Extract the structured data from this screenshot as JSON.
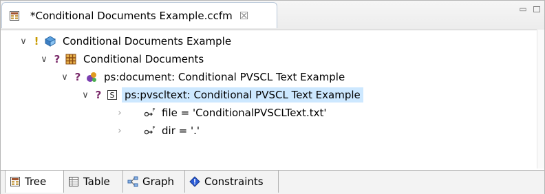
{
  "editor": {
    "tab_title": "*Conditional Documents Example.ccfm",
    "close_glyph": "☒"
  },
  "tree": {
    "nodes": [
      {
        "label": "Conditional Documents Example",
        "flag": "!",
        "icon": "model-icon"
      },
      {
        "label": "Conditional Documents",
        "flag": "?",
        "icon": "grid-icon"
      },
      {
        "label": "ps:document: Conditional PVSCL Text Example",
        "flag": "?",
        "icon": "component-icon"
      },
      {
        "label": "ps:pvscltext: Conditional PVSCL Text Example",
        "flag": "?",
        "icon": "s-icon"
      },
      {
        "label": "file = 'ConditionalPVSCLText.txt'",
        "icon": "attribute-f-icon"
      },
      {
        "label": "dir = '.'",
        "icon": "attribute-f-icon"
      }
    ]
  },
  "bottom_tabs": [
    {
      "label": "Tree"
    },
    {
      "label": "Table"
    },
    {
      "label": "Graph"
    },
    {
      "label": "Constraints"
    }
  ],
  "colors": {
    "selection": "#cde8ff",
    "question_mark": "#7a2a6a",
    "exclaim": "#c89a00"
  }
}
